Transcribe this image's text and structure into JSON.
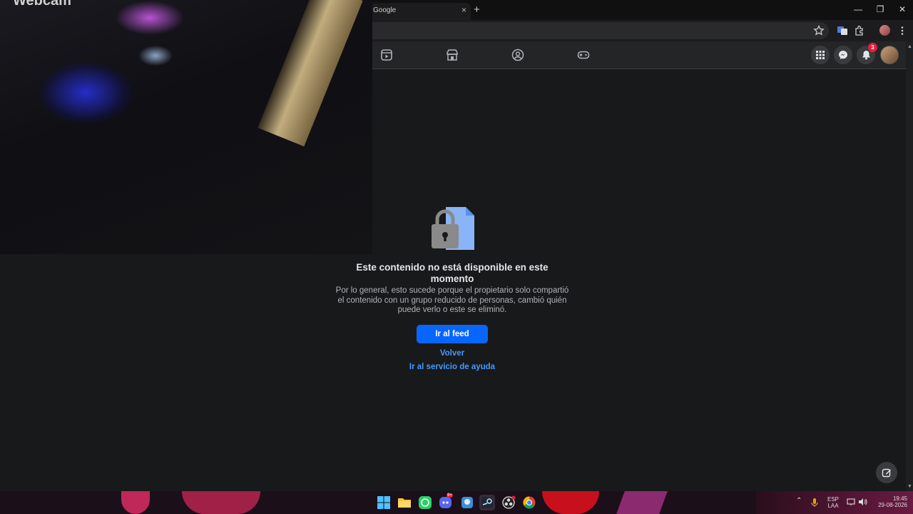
{
  "browser": {
    "tab_title": "Google",
    "tab_close": "×",
    "new_tab": "+",
    "window_controls": {
      "minimize": "—",
      "restore": "❐",
      "close": "✕"
    }
  },
  "facebook": {
    "notifications_count": "3",
    "nav_icons": [
      "reels-icon",
      "marketplace-icon",
      "groups-icon",
      "gaming-icon"
    ]
  },
  "webcam": {
    "label": "Webcam"
  },
  "content": {
    "title": "Este contenido no está disponible en este momento",
    "description": "Por lo general, esto sucede porque el propietario solo compartió el contenido con un grupo reducido de personas, cambió quién puede verlo o este se eliminó.",
    "primary_button": "Ir al feed",
    "back_link": "Volver",
    "help_link": "Ir al servicio de ayuda"
  },
  "taskbar": {
    "discord_badge": "9+",
    "language_top": "ESP",
    "language_bottom": "LAA",
    "time": "19:45",
    "date": "29-08-2026"
  },
  "colors": {
    "accent": "#0866ff",
    "link": "#4599ff",
    "background": "#18191a",
    "header": "#242526"
  }
}
